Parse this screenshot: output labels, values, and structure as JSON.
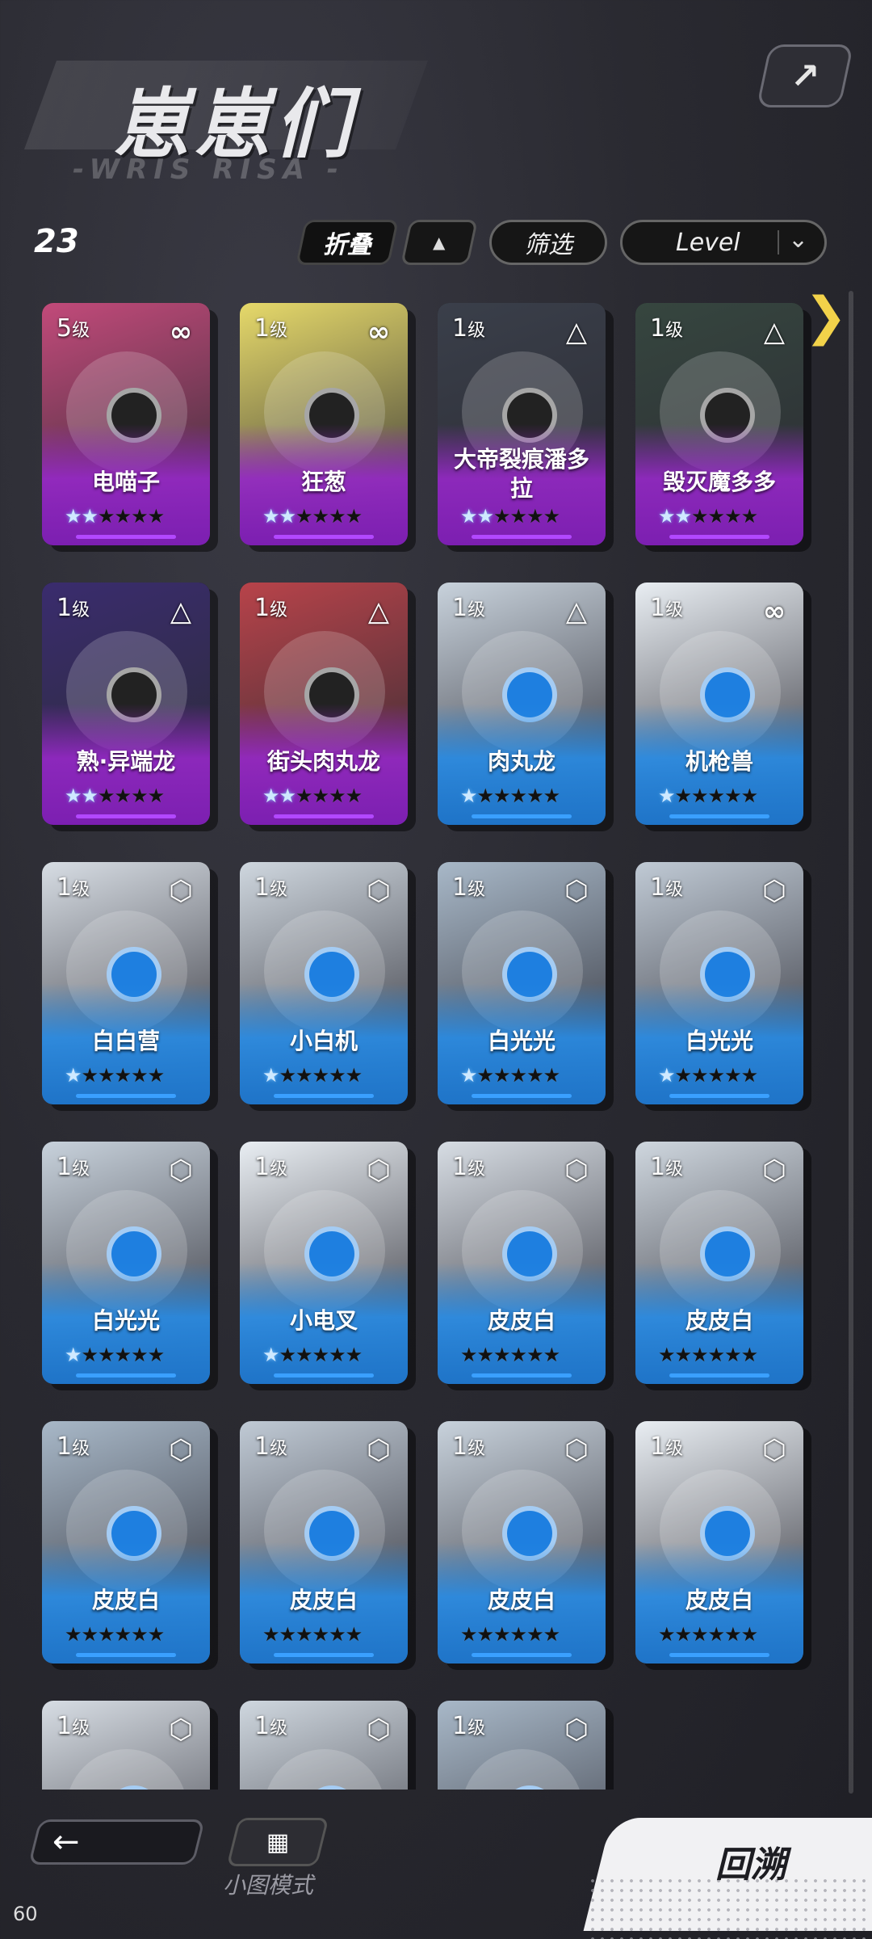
{
  "header": {
    "title": "崽崽们",
    "subtitle": "-WRIS RISA -",
    "corner_icon": "share-arrow-icon"
  },
  "toolbar": {
    "count": "23",
    "fold_label": "折叠",
    "sort_icon": "triangle-up-icon",
    "filter_label": "筛选",
    "sort_select": "Level",
    "dropdown_icon": "chevron-down-icon",
    "next_icon": "chevron-right-icon"
  },
  "cards": [
    {
      "level": "5",
      "unit": "级",
      "name": "电喵子",
      "badge": "infinity",
      "color": "purple",
      "stars_lit": 2
    },
    {
      "level": "1",
      "unit": "级",
      "name": "狂葱",
      "badge": "infinity",
      "color": "purple",
      "stars_lit": 2
    },
    {
      "level": "1",
      "unit": "级",
      "name": "大帝裂痕潘多拉",
      "badge": "triangle",
      "color": "purple",
      "stars_lit": 2
    },
    {
      "level": "1",
      "unit": "级",
      "name": "毁灭魔多多",
      "badge": "triangle",
      "color": "purple",
      "stars_lit": 2
    },
    {
      "level": "1",
      "unit": "级",
      "name": "熟·异端龙",
      "badge": "triangle",
      "color": "purple",
      "stars_lit": 2
    },
    {
      "level": "1",
      "unit": "级",
      "name": "街头肉丸龙",
      "badge": "triangle",
      "color": "purple",
      "stars_lit": 2
    },
    {
      "level": "1",
      "unit": "级",
      "name": "肉丸龙",
      "badge": "triangle",
      "color": "blue",
      "stars_lit": 1
    },
    {
      "level": "1",
      "unit": "级",
      "name": "机枪兽",
      "badge": "infinity",
      "color": "blue",
      "stars_lit": 1
    },
    {
      "level": "1",
      "unit": "级",
      "name": "白白营",
      "badge": "hexagon",
      "color": "blue",
      "stars_lit": 1
    },
    {
      "level": "1",
      "unit": "级",
      "name": "小白机",
      "badge": "hexagon",
      "color": "blue",
      "stars_lit": 1
    },
    {
      "level": "1",
      "unit": "级",
      "name": "白光光",
      "badge": "hexagon",
      "color": "blue",
      "stars_lit": 1
    },
    {
      "level": "1",
      "unit": "级",
      "name": "白光光",
      "badge": "hexagon",
      "color": "blue",
      "stars_lit": 1
    },
    {
      "level": "1",
      "unit": "级",
      "name": "白光光",
      "badge": "hexagon",
      "color": "blue",
      "stars_lit": 1
    },
    {
      "level": "1",
      "unit": "级",
      "name": "小电叉",
      "badge": "hexagon",
      "color": "blue",
      "stars_lit": 1
    },
    {
      "level": "1",
      "unit": "级",
      "name": "皮皮白",
      "badge": "hexagon",
      "color": "blue",
      "stars_lit": 0
    },
    {
      "level": "1",
      "unit": "级",
      "name": "皮皮白",
      "badge": "hexagon",
      "color": "blue",
      "stars_lit": 0
    },
    {
      "level": "1",
      "unit": "级",
      "name": "皮皮白",
      "badge": "hexagon",
      "color": "blue",
      "stars_lit": 0
    },
    {
      "level": "1",
      "unit": "级",
      "name": "皮皮白",
      "badge": "hexagon",
      "color": "blue",
      "stars_lit": 0
    },
    {
      "level": "1",
      "unit": "级",
      "name": "皮皮白",
      "badge": "hexagon",
      "color": "blue",
      "stars_lit": 0
    },
    {
      "level": "1",
      "unit": "级",
      "name": "皮皮白",
      "badge": "hexagon",
      "color": "blue",
      "stars_lit": 0
    },
    {
      "level": "1",
      "unit": "级",
      "name": "",
      "badge": "hexagon",
      "color": "blue",
      "stars_lit": 0
    },
    {
      "level": "1",
      "unit": "级",
      "name": "",
      "badge": "hexagon",
      "color": "blue",
      "stars_lit": 0
    },
    {
      "level": "1",
      "unit": "级",
      "name": "",
      "badge": "hexagon",
      "color": "blue",
      "stars_lit": 0
    }
  ],
  "footer": {
    "back_icon": "arrow-left-icon",
    "mode_icon": "grid-icon",
    "mode_label": "小图模式",
    "trace_label": "回溯",
    "fps": "60"
  },
  "colors": {
    "accent_yellow": "#f2d24a",
    "purple_card": "#7c1fb1",
    "blue_card": "#1f74c8"
  }
}
